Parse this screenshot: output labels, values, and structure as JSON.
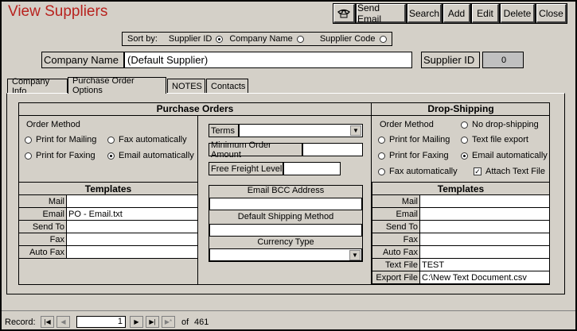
{
  "title": "View Suppliers",
  "toolbar": {
    "phone_icon": "phone-icon",
    "send_email": "Send Email",
    "search": "Search",
    "add": "Add",
    "edit": "Edit",
    "delete": "Delete",
    "close": "Close"
  },
  "sort": {
    "label": "Sort by:",
    "options": [
      {
        "label": "Supplier ID",
        "selected": true
      },
      {
        "label": "Company Name",
        "selected": false
      },
      {
        "label": "Supplier Code",
        "selected": false
      }
    ]
  },
  "header": {
    "company_name_label": "Company Name",
    "company_name_value": "(Default Supplier)",
    "supplier_id_label": "Supplier ID",
    "supplier_id_value": "0"
  },
  "tabs": [
    {
      "label": "Company Info",
      "active": false
    },
    {
      "label": "Purchase Order Options",
      "active": true
    },
    {
      "label": "NOTES",
      "active": false
    },
    {
      "label": "Contacts",
      "active": false
    }
  ],
  "purchase_orders": {
    "heading": "Purchase Orders",
    "order_method_label": "Order Method",
    "options": [
      {
        "label": "Print for Mailing",
        "selected": false
      },
      {
        "label": "Fax automatically",
        "selected": false
      },
      {
        "label": "Print for Faxing",
        "selected": false
      },
      {
        "label": "Email automatically",
        "selected": true
      }
    ],
    "templates_heading": "Templates",
    "templates": [
      {
        "label": "Mail",
        "value": ""
      },
      {
        "label": "Email",
        "value": "PO - Email.txt"
      },
      {
        "label": "Send To",
        "value": ""
      },
      {
        "label": "Fax",
        "value": ""
      },
      {
        "label": "Auto Fax",
        "value": ""
      }
    ]
  },
  "middle": {
    "terms_label": "Terms",
    "terms_value": "",
    "min_order_label": "Minimum Order Amount",
    "min_order_value": "",
    "free_freight_label": "Free Freight Level",
    "free_freight_value": "",
    "email_bcc_label": "Email BCC Address",
    "email_bcc_value": "",
    "default_shipping_label": "Default Shipping Method",
    "default_shipping_value": "",
    "currency_label": "Currency Type",
    "currency_value": ""
  },
  "drop_shipping": {
    "heading": "Drop-Shipping",
    "order_method_label": "Order Method",
    "options": [
      {
        "label": "No drop-shipping",
        "selected": false
      },
      {
        "label": "Print for Mailing",
        "selected": false
      },
      {
        "label": "Text file export",
        "selected": false
      },
      {
        "label": "Print for Faxing",
        "selected": false
      },
      {
        "label": "Email automatically",
        "selected": true
      },
      {
        "label": "Fax automatically",
        "selected": false
      }
    ],
    "attach_text_label": "Attach Text File",
    "attach_text_checked": true,
    "templates_heading": "Templates",
    "templates": [
      {
        "label": "Mail",
        "value": ""
      },
      {
        "label": "Email",
        "value": ""
      },
      {
        "label": "Send To",
        "value": ""
      },
      {
        "label": "Fax",
        "value": ""
      },
      {
        "label": "Auto Fax",
        "value": ""
      },
      {
        "label": "Text File",
        "value": "TEST"
      },
      {
        "label": "Export File",
        "value": "C:\\New Text Document.csv"
      }
    ]
  },
  "record_nav": {
    "label": "Record:",
    "current": "1",
    "of_label": "of",
    "total": "461"
  }
}
